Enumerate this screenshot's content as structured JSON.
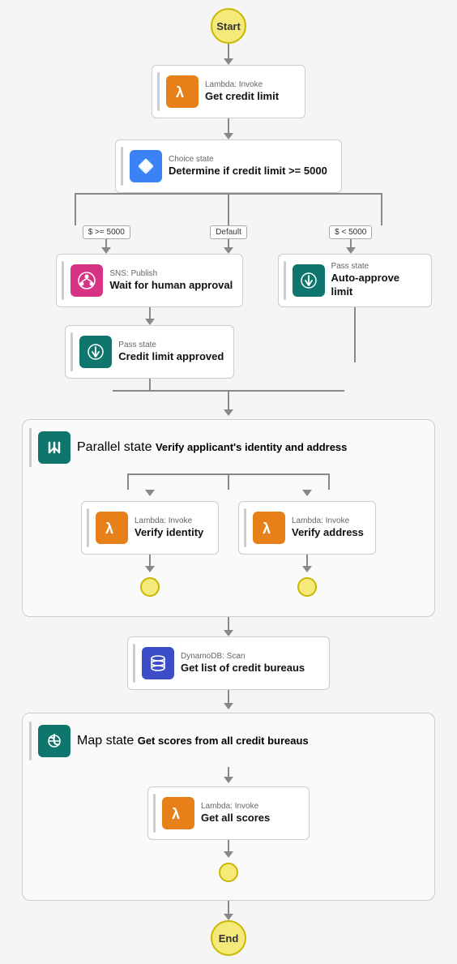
{
  "nodes": {
    "start": "Start",
    "end": "End",
    "lambda_get_credit": {
      "label_top": "Lambda: Invoke",
      "label_main": "Get credit limit",
      "icon_type": "lambda",
      "icon_color": "orange"
    },
    "choice_state": {
      "label_top": "Choice state",
      "label_main": "Determine if credit limit >= 5000",
      "icon_type": "choice",
      "icon_color": "blue"
    },
    "sns_wait": {
      "label_top": "SNS: Publish",
      "label_main": "Wait for human approval",
      "icon_type": "sns",
      "icon_color": "pink"
    },
    "pass_approved": {
      "label_top": "Pass state",
      "label_main": "Credit limit approved",
      "icon_type": "pass",
      "icon_color": "teal"
    },
    "pass_auto": {
      "label_top": "Pass state",
      "label_main": "Auto-approve limit",
      "icon_type": "pass",
      "icon_color": "teal"
    },
    "parallel_state": {
      "label_top": "Parallel state",
      "label_main": "Verify applicant's identity and address",
      "icon_type": "parallel",
      "icon_color": "teal"
    },
    "lambda_identity": {
      "label_top": "Lambda: Invoke",
      "label_main": "Verify identity",
      "icon_type": "lambda",
      "icon_color": "orange"
    },
    "lambda_address": {
      "label_top": "Lambda: Invoke",
      "label_main": "Verify address",
      "icon_type": "lambda",
      "icon_color": "orange"
    },
    "dynamo_scan": {
      "label_top": "DynamoDB: Scan",
      "label_main": "Get list of credit bureaus",
      "icon_type": "dynamo",
      "icon_color": "blue"
    },
    "map_state": {
      "label_top": "Map state",
      "label_main": "Get scores from all credit bureaus",
      "icon_type": "map",
      "icon_color": "teal"
    },
    "lambda_scores": {
      "label_top": "Lambda: Invoke",
      "label_main": "Get all scores",
      "icon_type": "lambda",
      "icon_color": "orange"
    }
  },
  "branch_labels": {
    "gte_5000": "$ >= 5000",
    "default": "Default",
    "lt_5000": "$ < 5000"
  }
}
